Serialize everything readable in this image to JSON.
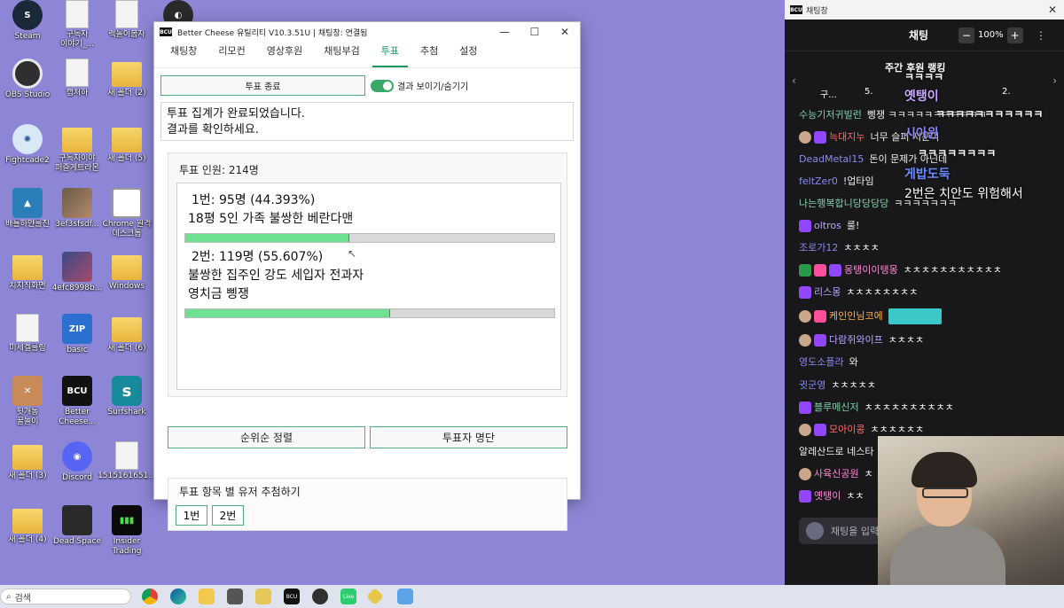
{
  "desktop": {
    "icons": [
      {
        "label": "Steam"
      },
      {
        "label": "구독자\n이야기_..."
      },
      {
        "label": "렉돌이봄자"
      },
      {
        "label": "OBS Studio"
      },
      {
        "label": "캡처하"
      },
      {
        "label": "새 폴더 (2)"
      },
      {
        "label": "Fightcade2"
      },
      {
        "label": "구독자이야\n퍼즐게트라몬"
      },
      {
        "label": "새 폴더 (5)"
      },
      {
        "label": "배틀하얀룰진"
      },
      {
        "label": "3ef3sfsdf..."
      },
      {
        "label": "Chrome 원격\n데스크톱"
      },
      {
        "label": "치지직화면"
      },
      {
        "label": "4efc8998b..."
      },
      {
        "label": "Windows"
      },
      {
        "label": "미세겔룰링"
      },
      {
        "label": "basic"
      },
      {
        "label": "새 폴더 (6)"
      },
      {
        "label": "뒷개통\n꿀놀이"
      },
      {
        "label": "Better\nCheese..."
      },
      {
        "label": "Surfshark"
      },
      {
        "label": "새 폴더 (3)"
      },
      {
        "label": "Discord"
      },
      {
        "label": "1515161651..."
      },
      {
        "label": "새 폴더 (4)"
      },
      {
        "label": "Dead Space"
      },
      {
        "label": "Insider\nTrading"
      }
    ]
  },
  "app": {
    "title": "Better Cheese 유틸리티 V10.3.51U | 채팅창: 연결됨",
    "badge": "BCU",
    "tabs": [
      "채팅창",
      "리모컨",
      "영상후원",
      "채팅부검",
      "투표",
      "추첨",
      "설정"
    ],
    "active_tab": "투표",
    "end_button": "투표 종료",
    "toggle_label": "결과 보이기/숨기기",
    "message_line1": "투표 집계가 완료되었습니다.",
    "message_line2": "결과를 확인하세요.",
    "voters": "투표 인원: 214명",
    "options": [
      {
        "result": "1번: 95명 (44.393%)",
        "text_line1": "18평 5인 가족 불쌍한 베란다맨",
        "text_line2": "",
        "percent": 44.393
      },
      {
        "result": "2번: 119명 (55.607%)",
        "text_line1": "불쌍한 집주인 강도 세입자 전과자",
        "text_line2": "영치금 삥쟁",
        "percent": 55.607
      }
    ],
    "sort_button": "순위순 정렬",
    "voters_list_button": "투표자 명단",
    "draw_title": "투표 항목 별 유저 추첨하기",
    "draw_buttons": [
      "1번",
      "2번"
    ],
    "accent_color": "#1a9a5a",
    "bar_fill_color": "#6ee08f"
  },
  "chat": {
    "window_title": "채팅창",
    "header_title": "채팅",
    "zoom": "100%",
    "zoom_minus": "−",
    "zoom_plus": "+",
    "more": "⋮",
    "rank_title": "주간 후원 랭킹",
    "rank_items": [
      "구...",
      "5.",
      "2."
    ],
    "lines": [
      {
        "nick": "수능기저귀빌런",
        "msg": "삥쟁  ㅋㅋㅋㅋㅋㅋㅋㅋㅋㅋㅋ",
        "nick_color": "#7fd1a8"
      },
      {
        "nick": "늑대지누",
        "msg": "너무 슬퍼 저분이",
        "nick_color": "#ff6b6b"
      },
      {
        "nick": "DeadMetal15",
        "msg": "돈이 문제가 아닌데",
        "nick_color": "#8a8af0"
      },
      {
        "nick": "feltZer0",
        "msg": "!업타임",
        "nick_color": "#8a8af0"
      },
      {
        "nick": "나는행복합니당당당당",
        "msg": "ㅋㅋㅋㅋㅋㅋㅋ",
        "nick_color": "#7fd1a8"
      },
      {
        "nick": "oltros",
        "msg": "룰!",
        "nick_color": "#b9a6ff"
      },
      {
        "nick": "조로가12",
        "msg": "ㅊㅊㅊㅊ",
        "nick_color": "#8a8af0"
      },
      {
        "nick": "몽탱이이탱몽",
        "msg": "ㅊㅊㅊㅊㅊㅊㅊㅊㅊㅊㅊ",
        "nick_color": "#ff8ad6"
      },
      {
        "nick": "리스몽",
        "msg": "ㅊㅊㅊㅊㅊㅊㅊㅊ",
        "nick_color": "#b9a6ff"
      },
      {
        "nick": "케인인님코에",
        "msg": "",
        "nick_color": "#ffb347"
      },
      {
        "nick": "다람쥐와이프",
        "msg": "ㅊㅊㅊㅊ",
        "nick_color": "#b9a6ff"
      },
      {
        "nick": "영도소플라",
        "msg": "와",
        "nick_color": "#8a8af0"
      },
      {
        "nick": "귓군영",
        "msg": "ㅊㅊㅊㅊㅊ",
        "nick_color": "#8a8af0"
      },
      {
        "nick": "블루메신저",
        "msg": "ㅊㅊㅊㅊㅊㅊㅊㅊㅊㅊ",
        "nick_color": "#7fd1a8"
      },
      {
        "nick": "모아이콩",
        "msg": "ㅊㅊㅊㅊㅊㅊ",
        "nick_color": "#ff6b6b"
      },
      {
        "nick": "알레산드로 네스타",
        "msg": "",
        "nick_color": "#efeff1"
      },
      {
        "nick": "사육신공원",
        "msg": "ㅊ",
        "nick_color": "#ff8ad6"
      },
      {
        "nick": "옛탱이",
        "msg": "ㅊㅊ",
        "nick_color": "#ff8ad6"
      }
    ],
    "overlay_texts": [
      "ㅋㅋㅋㅋ",
      "옛탱이",
      "ㅋㅋㅋㅋㅋㅋㅋㅋㅋㅋㅋ",
      "시아윈",
      "ㅋㅋㅋㅋㅋㅋㅋㅋ",
      "게밥도둑",
      "2번은 치안도 위험해서"
    ],
    "input_placeholder": "채팅을 입력"
  },
  "taskbar": {
    "search_placeholder": "검색",
    "pinned": [
      "chrome",
      "edge",
      "file-explorer",
      "app",
      "notepad-folder",
      "bcu",
      "obs",
      "live",
      "sticker",
      "notepad"
    ]
  }
}
